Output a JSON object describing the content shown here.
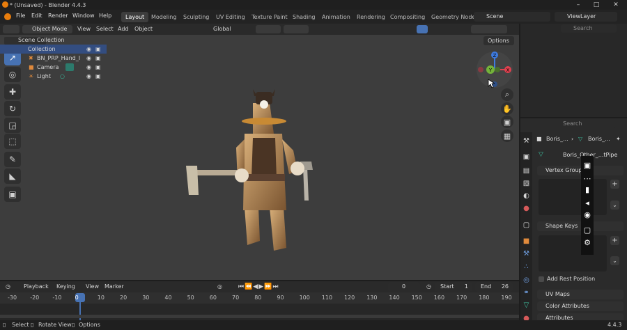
{
  "window": {
    "title": "* (Unsaved) - Blender 4.4.3",
    "minimize": "–",
    "maximize": "□",
    "close": "✕"
  },
  "menu": {
    "items": [
      "File",
      "Edit",
      "Render",
      "Window",
      "Help"
    ],
    "workspaces": [
      "Layout",
      "Modeling",
      "Sculpting",
      "UV Editing",
      "Texture Paint",
      "Shading",
      "Animation",
      "Rendering",
      "Compositing",
      "Geometry Node"
    ],
    "active_workspace": "Layout",
    "scene": "Scene",
    "view_layer": "ViewLayer"
  },
  "viewport_header": {
    "mode": "Object Mode",
    "menus": [
      "View",
      "Select",
      "Add",
      "Object"
    ],
    "transform_orientation": "Global",
    "options_label": "Options"
  },
  "gizmo": {
    "x": "X",
    "y": "Y",
    "z": "Z"
  },
  "outliner": {
    "search_placeholder": "Search",
    "scene_collection": "Scene Collection",
    "collection": "Collection",
    "objects": [
      "BN_PRP_Hand_I",
      "Camera",
      "Light"
    ]
  },
  "properties": {
    "search_placeholder": "Search",
    "breadcrumb_object": "Boris_...",
    "breadcrumb_data": "Boris_...",
    "mesh_name": "Boris_Other_...tPipe",
    "panels": {
      "vertex_groups": "Vertex Groups",
      "shape_keys": "Shape Keys",
      "add_rest_position": "Add Rest Position",
      "uv_maps": "UV Maps",
      "color_attributes": "Color Attributes",
      "attributes": "Attributes"
    }
  },
  "timeline": {
    "menus": [
      "Playback",
      "Keying",
      "View",
      "Marker"
    ],
    "current_frame": "0",
    "start_label": "Start",
    "start": "1",
    "end_label": "End",
    "end": "26",
    "ticks": [
      "-30",
      "-20",
      "-10",
      "0",
      "10",
      "20",
      "30",
      "40",
      "50",
      "60",
      "70",
      "80",
      "90",
      "100",
      "110",
      "120",
      "130",
      "140",
      "150",
      "160",
      "170",
      "180",
      "190"
    ]
  },
  "status_bar": {
    "select": "Select",
    "rotate_view": "Rotate View",
    "options": "Options",
    "version": "4.4.3"
  },
  "colors": {
    "accent": "#4772b3",
    "viewport_bg": "#3d3d3d",
    "axis_x": "#e0414f",
    "axis_y": "#74b23a",
    "axis_z": "#3e7be0"
  }
}
